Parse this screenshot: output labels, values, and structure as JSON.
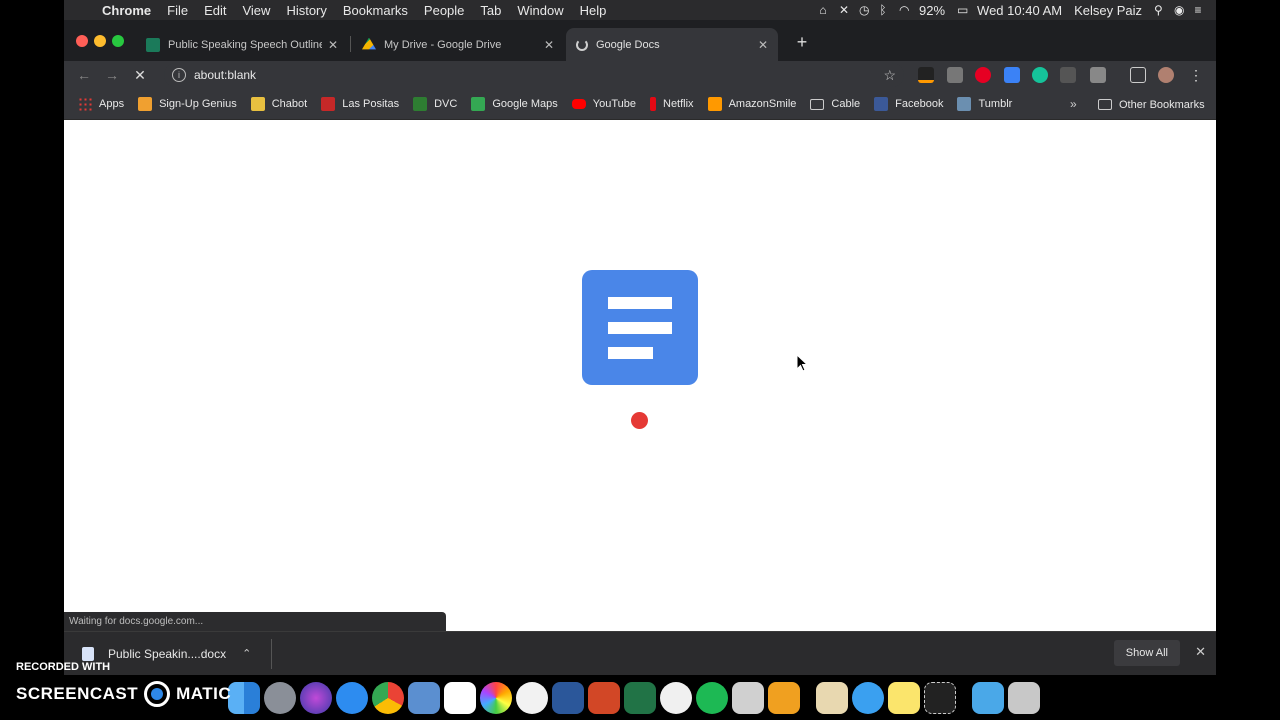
{
  "menubar": {
    "app_name": "Chrome",
    "menus": [
      "File",
      "Edit",
      "View",
      "History",
      "Bookmarks",
      "People",
      "Tab",
      "Window",
      "Help"
    ],
    "battery": "92%",
    "clock": "Wed 10:40 AM",
    "user": "Kelsey Paiz"
  },
  "tabs": [
    {
      "title": "Public Speaking Speech Outline",
      "favicon_color": "#1b7a5a",
      "active": false
    },
    {
      "title": "My Drive - Google Drive",
      "favicon_color": "#f4b400",
      "active": false
    },
    {
      "title": "Google Docs",
      "favicon_color": "#cfcfcf",
      "active": true
    }
  ],
  "toolbar": {
    "url": "about:blank",
    "back_icon": "back-arrow-icon",
    "forward_icon": "forward-arrow-icon",
    "reload_icon": "stop-loading-icon"
  },
  "bookmarks": [
    {
      "label": "Apps",
      "color": "#e53935"
    },
    {
      "label": "Sign-Up Genius",
      "color": "#f0a030"
    },
    {
      "label": "Chabot",
      "color": "#e8c040"
    },
    {
      "label": "Las Positas",
      "color": "#c62828"
    },
    {
      "label": "DVC",
      "color": "#2e7d32"
    },
    {
      "label": "Google Maps",
      "color": "#34a853"
    },
    {
      "label": "YouTube",
      "color": "#ff0000"
    },
    {
      "label": "Netflix",
      "color": "#e50914"
    },
    {
      "label": "AmazonSmile",
      "color": "#ff9900"
    },
    {
      "label": "Cable",
      "color": "#cccccc"
    },
    {
      "label": "Facebook",
      "color": "#3b5998"
    },
    {
      "label": "Tumblr",
      "color": "#6b8fb0"
    }
  ],
  "bookmarks_more": "»",
  "other_bookmarks": "Other Bookmarks",
  "status": "Waiting for docs.google.com...",
  "download": {
    "filename": "Public Speakin....docx",
    "show_all": "Show All"
  },
  "watermark": {
    "line1": "RECORDED WITH",
    "brand_left": "SCREENCAST",
    "brand_right": "MATIC"
  },
  "colors": {
    "docs_blue": "#4a86e8",
    "loader_red": "#e53935"
  }
}
